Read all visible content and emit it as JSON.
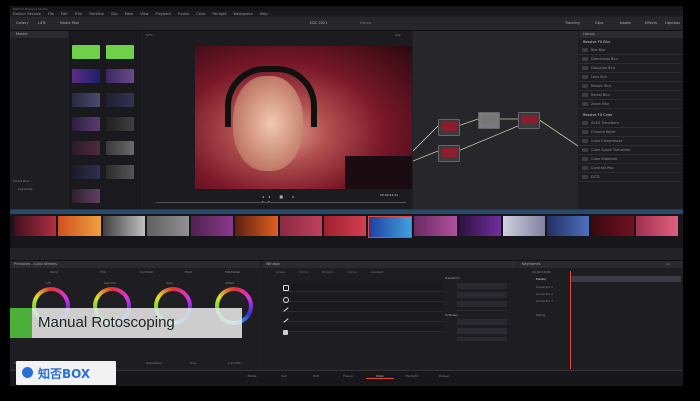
{
  "app": {
    "title": "DaVinci Resolve Studio",
    "menus": [
      "DaVinci Resolve",
      "File",
      "Edit",
      "Trim",
      "Timeline",
      "Clip",
      "Mark",
      "View",
      "Playback",
      "Fusion",
      "Color",
      "Fairlight",
      "Workspace",
      "Help"
    ],
    "toolbar": {
      "gallery": "Gallery",
      "luts": "LUTs",
      "media_pool": "Media Pool",
      "timeline_name": "EDC 2021",
      "edited": "Edited",
      "timecode": "00:00:16:17",
      "clip": "Clip",
      "tracker": "Tracking",
      "fx": "Clips",
      "nodes": "Nodes",
      "effects": "Effects",
      "lightbox": "Lightbox"
    },
    "colors": {
      "bg": "#202024",
      "accent": "#e5483a",
      "callout_green": "#4caf3a",
      "node_red": "#8a1e2c"
    }
  },
  "media_pool": {
    "header": "Master",
    "sidebar_label": "Smart Bins",
    "sidebar_item": "Keywords"
  },
  "viewer": {
    "zoom": "57%",
    "timecode": "00:00:24:21"
  },
  "library": {
    "header": "Library",
    "section1": "Resolve FX Blur",
    "blur_items": [
      "Box Blur",
      "Directional Blur",
      "Gaussian Blur",
      "Lens Blur",
      "Mosaic Blur",
      "Radial Blur",
      "Zoom Blur"
    ],
    "section2": "Resolve FX Color",
    "color_items": [
      "ACES Transform",
      "Chroma Keyer",
      "Color Compressor",
      "Color Space Transform",
      "Color Stabilizer",
      "Contrast Pop",
      "DCTL"
    ]
  },
  "color_wheels": {
    "header": "Primaries - Color Wheels",
    "temp_label": "Temp",
    "tint_label": "Tint",
    "contrast_label": "Contrast",
    "pivot_label": "Pivot",
    "md_label": "Mid/Detail",
    "wheels": [
      "Lift",
      "Gamma",
      "Gain",
      "Offset"
    ],
    "bottom": [
      "Col Boost",
      "Shad",
      "Hi/Light",
      "Saturation",
      "Hue",
      "Lum Mix"
    ]
  },
  "window_panel": {
    "header": "Window",
    "tabs": [
      "Linear",
      "Circle",
      "Polygon",
      "Curve",
      "Gradient"
    ],
    "transform": "Transform",
    "softness": "Softness"
  },
  "keyframes": {
    "header": "Keyframes",
    "all": "All",
    "timecode": "00:00:16:00",
    "master": "Master",
    "tracks": [
      "Corrector 1",
      "Corrector 2",
      "Corrector 3",
      "Sizing"
    ]
  },
  "pages": [
    "Media",
    "Cut",
    "Edit",
    "Fusion",
    "Color",
    "Fairlight",
    "Deliver"
  ],
  "callout": "Manual Rotoscoping",
  "logo": "知否BOX"
}
